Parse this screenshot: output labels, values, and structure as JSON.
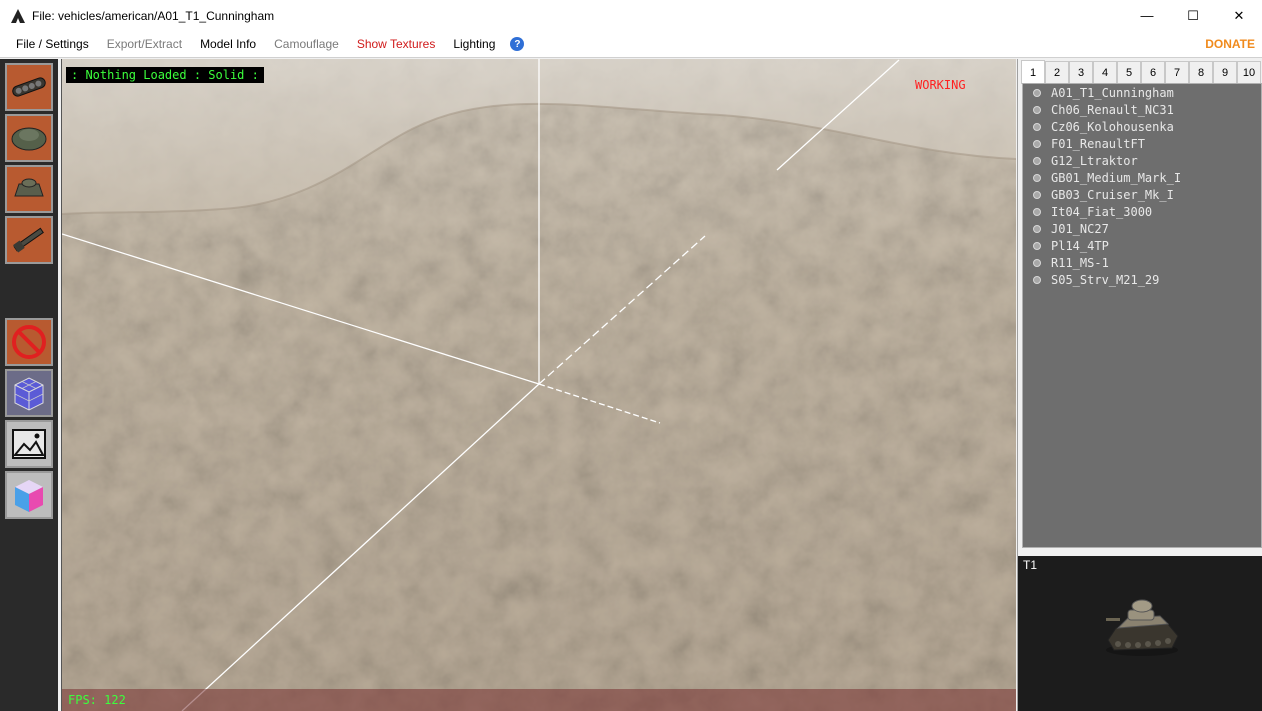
{
  "window": {
    "title": "File: vehicles/american/A01_T1_Cunningham",
    "minimize_glyph": "—",
    "maximize_glyph": "☐",
    "close_glyph": "✕"
  },
  "menu": {
    "file_settings": "File / Settings",
    "export_extract": "Export/Extract",
    "model_info": "Model Info",
    "camouflage": "Camouflage",
    "show_textures": "Show Textures",
    "lighting": "Lighting",
    "help": "?",
    "donate": "DONATE"
  },
  "colors": {
    "show_textures": "#d01a1a",
    "disabled_menu": "#7a7a7a",
    "donate": "#f08a1c",
    "status_green": "#3cff3c",
    "working_red": "#ff2020"
  },
  "toolbar": {
    "icons": [
      "tank-chassis-icon",
      "tank-hull-icon",
      "tank-turret-icon",
      "tank-gun-icon",
      "no-camouflage-icon",
      "wireframe-cube-icon",
      "image-icon",
      "color-cube-icon"
    ]
  },
  "viewport": {
    "status": ": Nothing Loaded : Solid :",
    "working": "WORKING",
    "fps": "FPS: 122"
  },
  "right_panel": {
    "tabs": [
      "1",
      "2",
      "3",
      "4",
      "5",
      "6",
      "7",
      "8",
      "9",
      "10"
    ],
    "active_tab": "1",
    "tanks": [
      "A01_T1_Cunningham",
      "Ch06_Renault_NC31",
      "Cz06_Kolohousenka",
      "F01_RenaultFT",
      "G12_Ltraktor",
      "GB01_Medium_Mark_I",
      "GB03_Cruiser_Mk_I",
      "It04_Fiat_3000",
      "J01_NC27",
      "Pl14_4TP",
      "R11_MS-1",
      "S05_Strv_M21_29"
    ],
    "preview_label": "T1"
  }
}
